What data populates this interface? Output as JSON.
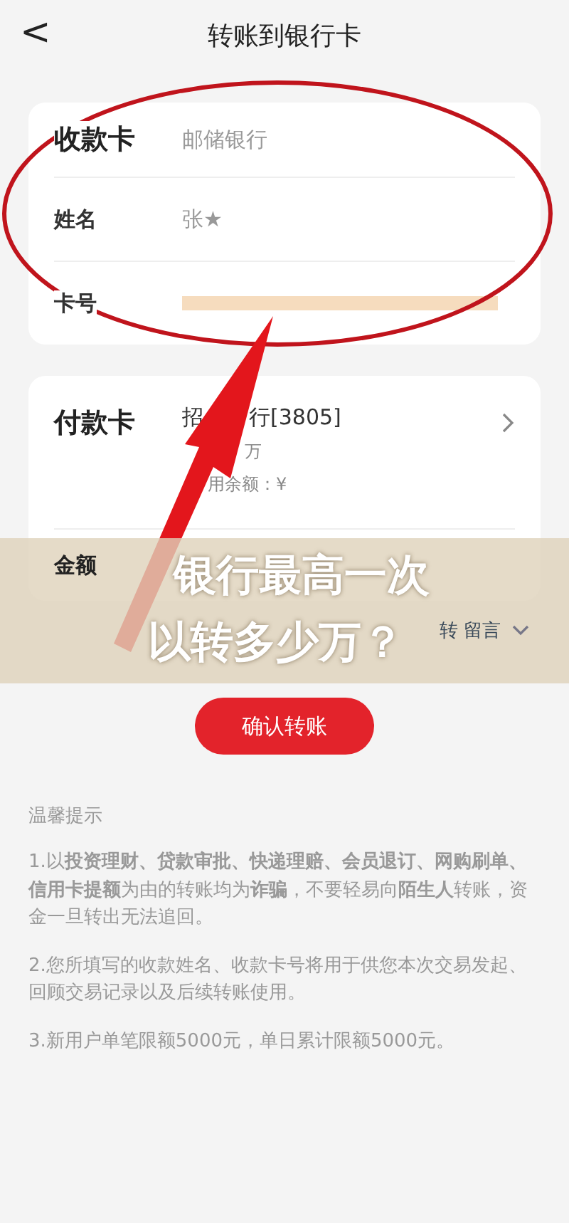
{
  "header": {
    "back_icon": "<",
    "title": "转账到银行卡"
  },
  "payee_card": {
    "title": "收款卡",
    "bank": "邮储银行",
    "rows": [
      {
        "label": "姓名",
        "value": "张★",
        "kind": "text"
      },
      {
        "label": "卡号",
        "kind": "masked"
      }
    ]
  },
  "payer_card": {
    "title": "付款卡",
    "bank_parts": [
      "招",
      "行[3805]"
    ],
    "limit": "万",
    "balance": "用余额：¥",
    "amount_label": "金额"
  },
  "remark": {
    "label": "转 留言"
  },
  "overlay": {
    "lines": [
      "银行最高一次",
      "以转多少万？"
    ]
  },
  "confirm_button": "确认转账",
  "tips": {
    "title": "温馨提示",
    "items": [
      "1.以**投资理财、贷款审批、快递理赔、会员退订、网购刷单、信用卡提额**为由的转账均为**诈骗**，不要轻易向**陌生人**转账，资金一旦转出无法追回。",
      "2.您所填写的收款姓名、收款卡号将用于供您本次交易发起、回顾交易记录以及后续转账使用。",
      "3.新用户单笔限额5000元，单日累计限额5000元。"
    ]
  }
}
